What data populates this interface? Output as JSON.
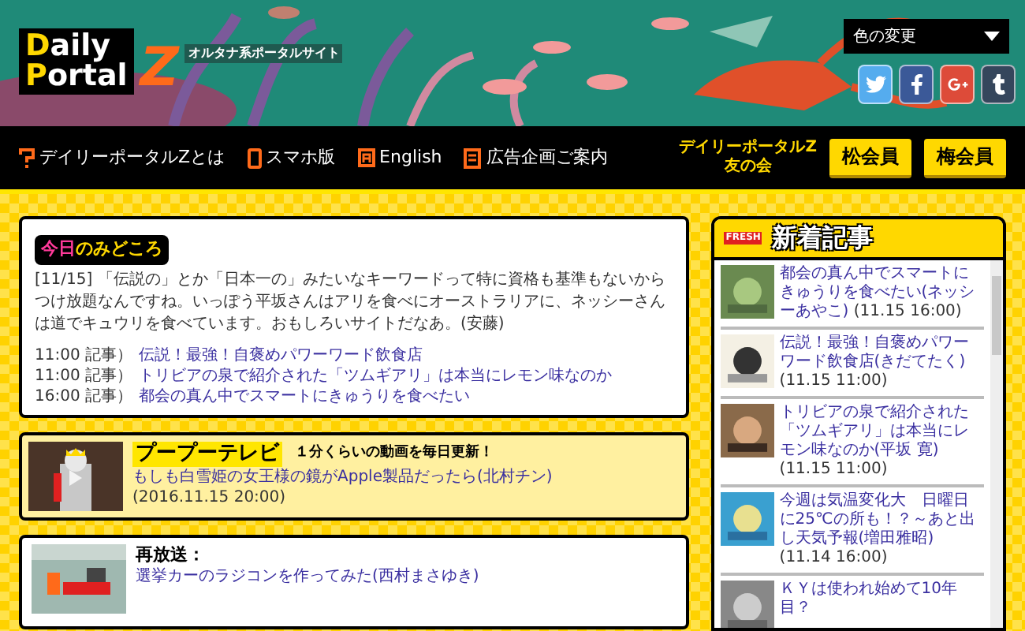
{
  "header": {
    "logo_lines": [
      "Daily",
      "Portal"
    ],
    "logo_z": "Z",
    "tagline": "オルタナ系ポータルサイト",
    "color_select": "色の変更",
    "social": [
      {
        "kind": "twitter"
      },
      {
        "kind": "facebook"
      },
      {
        "kind": "googleplus"
      },
      {
        "kind": "tumblr"
      }
    ]
  },
  "nav": {
    "items": [
      {
        "kind": "question",
        "label": "デイリーポータルZとは"
      },
      {
        "kind": "phone",
        "label": "スマホ版"
      },
      {
        "kind": "letter",
        "label": "English"
      },
      {
        "kind": "doc",
        "label": "広告企画ご案内"
      }
    ],
    "club": [
      "デイリーポータルZ",
      "友の会"
    ],
    "buttons": [
      "松会員",
      "梅会員"
    ]
  },
  "today": {
    "title_parts": [
      "今日",
      "のみどころ"
    ],
    "body": "[11/15] 「伝説の」とか「日本一の」みたいなキーワードって特に資格も基準もないからつけ放題なんですね。いっぽう平坂さんはアリを食べにオーストラリアに、ネッシーさんは道でキュウリを食べています。おもしろいサイトだなあ。(安藤)",
    "items": [
      {
        "time": "11:00",
        "label": "記事）",
        "title": "伝説！最強！自褒めパワーワード飲食店"
      },
      {
        "time": "11:00",
        "label": "記事）",
        "title": "トリビアの泉で紹介された「ツムギアリ」は本当にレモン味なのか"
      },
      {
        "time": "16:00",
        "label": "記事）",
        "title": "都会の真ん中でスマートにきゅうりを食べたい"
      }
    ]
  },
  "pupu": {
    "logo": "プープーテレビ",
    "tagline": "１分くらいの動画を毎日更新！",
    "link": "もしも白雪姫の女王様の鏡がApple製品だったら(北村チン)",
    "date": "(2016.11.15 20:00)"
  },
  "rerun": {
    "label": "再放送：",
    "link": "選挙カーのラジコンを作ってみた(西村まさゆき)"
  },
  "sidebar": {
    "badge": "FRESH",
    "title": "新着記事",
    "articles": [
      {
        "title": "都会の真ん中でスマートにきゅうりを食べたい(ネッシーあやこ)",
        "date": "(11.15 16:00)"
      },
      {
        "title": "伝説！最強！自褒めパワーワード飲食店(きだてたく)",
        "date": "(11.15 11:00)"
      },
      {
        "title": "トリビアの泉で紹介された「ツムギアリ」は本当にレモン味なのか(平坂 寛)",
        "date": "(11.15 11:00)"
      },
      {
        "title": "今週は気温変化大　日曜日に25℃の所も！？～あと出し天気予報(増田雅昭)",
        "date": "(11.14 16:00)"
      },
      {
        "title": "ＫＹは使われ始めて10年目？"
      }
    ]
  }
}
